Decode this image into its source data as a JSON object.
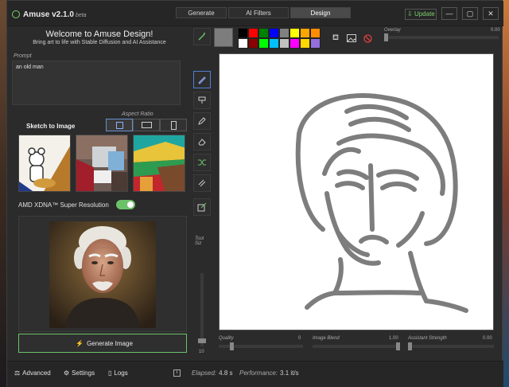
{
  "app": {
    "name": "Amuse v2.1.0",
    "beta": "beta",
    "update_label": "Update"
  },
  "tabs": [
    {
      "label": "Generate"
    },
    {
      "label": "AI Filters"
    },
    {
      "label": "Design"
    }
  ],
  "welcome": {
    "title": "Welcome to Amuse Design!",
    "subtitle": "Bring art to life with Stable Diffusion and AI Assistance"
  },
  "prompt": {
    "label": "Prompt",
    "value": "an old man"
  },
  "mode": {
    "title": "Sketch to Image",
    "aspect_label": "Aspect Ratio",
    "aspect_options": [
      "square",
      "landscape",
      "portrait"
    ],
    "selected_aspect": "square"
  },
  "xdna": {
    "label": "AMD XDNA™ Super Resolution",
    "enabled": true
  },
  "generate_button": "Generate Image",
  "bottom": {
    "advanced": "Advanced",
    "settings": "Settings",
    "logs": "Logs",
    "elapsed_label": "Elapsed:",
    "elapsed_value": "4.8 s",
    "performance_label": "Performance:",
    "performance_value": "3.1 it/s"
  },
  "toolbar": {
    "overlay_label": "Overlay",
    "overlay_value": "0.00",
    "current_color": "#7d7d7d",
    "palette": [
      "#000000",
      "#ff0000",
      "#008000",
      "#0000ff",
      "#808080",
      "#ffff00",
      "#ffa500",
      "#ff8c00",
      "#ffffff",
      "#8b0000",
      "#00ff00",
      "#00bfff",
      "#c0c0c0",
      "#ff00ff",
      "#ffd700",
      "#9370db"
    ]
  },
  "tool_size": {
    "label": "Tool Siz",
    "value": "10"
  },
  "sliders": {
    "quality_label": "Quality",
    "quality_value": "0",
    "image_blend_label": "Image Blend",
    "image_blend_value": "1.00",
    "assistant_label": "Assistant Strength",
    "assistant_value": "0.00"
  },
  "colors": {
    "accent_green": "#6cc26a",
    "accent_blue": "#4f7fd6",
    "sketch_stroke": "#7d7d7d"
  }
}
